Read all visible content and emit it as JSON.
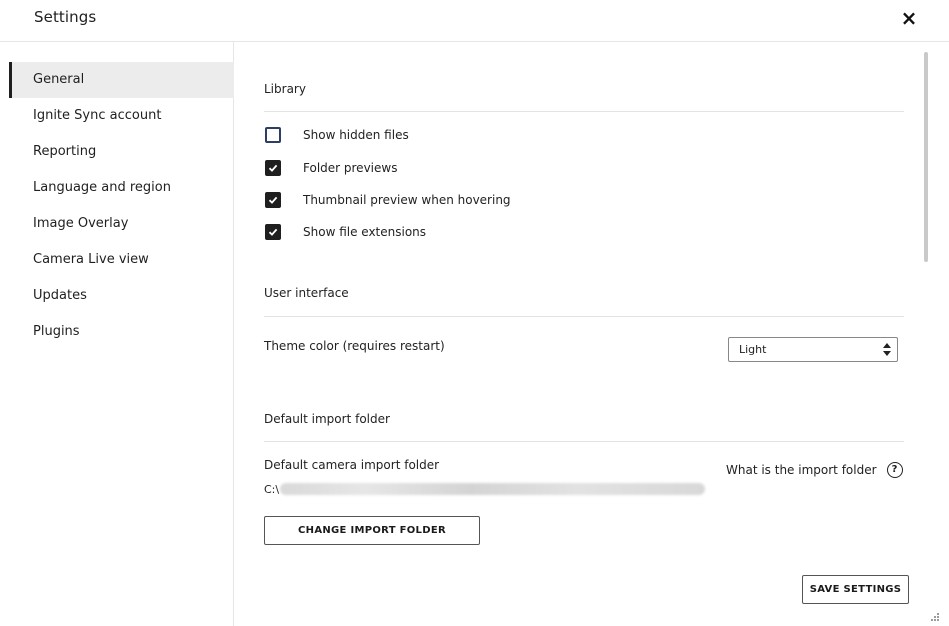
{
  "window": {
    "title": "Settings",
    "close_icon": "×"
  },
  "sidebar": {
    "items": [
      {
        "label": "General",
        "active": true
      },
      {
        "label": "Ignite Sync account",
        "active": false
      },
      {
        "label": "Reporting",
        "active": false
      },
      {
        "label": "Language and region",
        "active": false
      },
      {
        "label": "Image Overlay",
        "active": false
      },
      {
        "label": "Camera Live view",
        "active": false
      },
      {
        "label": "Updates",
        "active": false
      },
      {
        "label": "Plugins",
        "active": false
      }
    ]
  },
  "library": {
    "title": "Library",
    "options": [
      {
        "label": "Show hidden files",
        "checked": false
      },
      {
        "label": "Folder previews",
        "checked": true
      },
      {
        "label": "Thumbnail preview when hovering",
        "checked": true
      },
      {
        "label": "Show file extensions",
        "checked": true
      }
    ]
  },
  "user_interface": {
    "title": "User interface",
    "theme_label": "Theme color (requires restart)",
    "theme_value": "Light"
  },
  "import_folder": {
    "title": "Default import folder",
    "camera_label": "Default camera import folder",
    "path_prefix": "C:\\",
    "help_text": "What is the import folder",
    "help_icon": "?",
    "change_button": "CHANGE IMPORT FOLDER"
  },
  "footer": {
    "save_button": "SAVE SETTINGS"
  },
  "icons": {
    "close": "close-icon",
    "checkbox": "checkmark-icon",
    "select": "sort-arrows-icon",
    "help": "question-circle-icon",
    "resize": "resize-grip-icon"
  },
  "colors": {
    "active_nav_bg": "#ececec",
    "checkbox_checked": "#1f1f1f",
    "checkbox_unchecked_border": "#2c3e63"
  }
}
